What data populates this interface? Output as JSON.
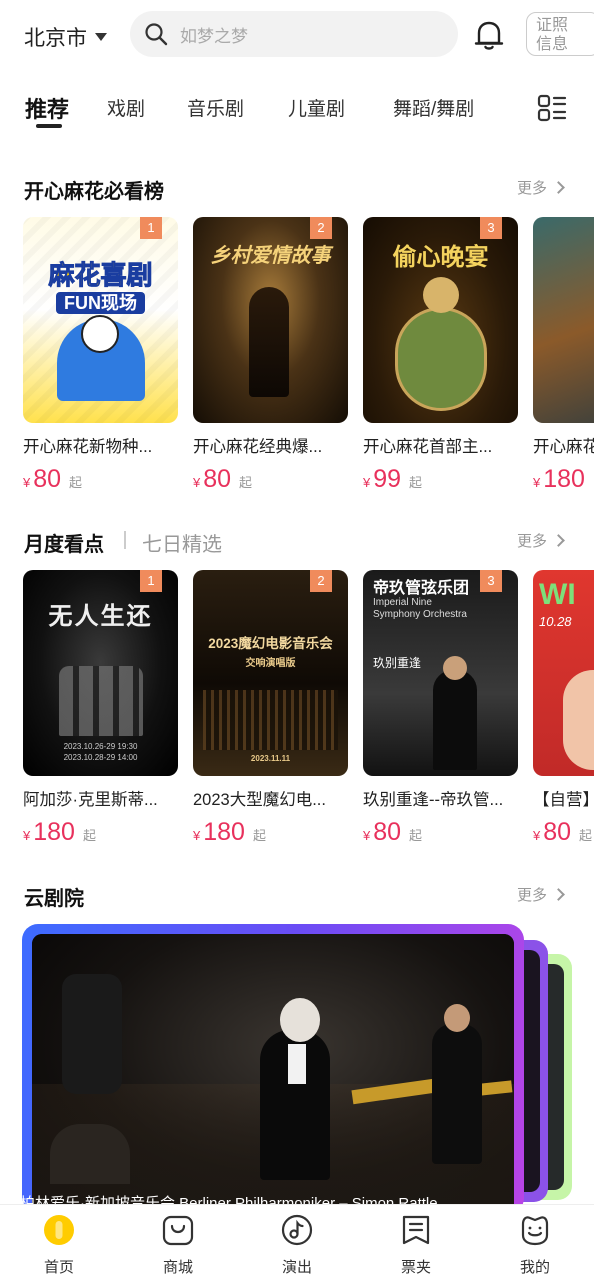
{
  "header": {
    "city": "北京市",
    "search_placeholder": "如梦之梦",
    "cert_label_line1": "证照",
    "cert_label_line2": "信息"
  },
  "tabs": [
    {
      "label": "推荐",
      "active": true
    },
    {
      "label": "戏剧",
      "active": false
    },
    {
      "label": "音乐剧",
      "active": false
    },
    {
      "label": "儿童剧",
      "active": false
    },
    {
      "label": "舞蹈/舞剧",
      "active": false
    }
  ],
  "sections": {
    "hot_list": {
      "title": "开心麻花必看榜",
      "more": "更多",
      "items": [
        {
          "rank": "1",
          "title": "开心麻花新物种...",
          "price": "80",
          "poster_text": [
            "麻花喜剧",
            "FUN现场"
          ]
        },
        {
          "rank": "2",
          "title": "开心麻花经典爆...",
          "price": "80",
          "poster_text": [
            "乡村爱情故事"
          ]
        },
        {
          "rank": "3",
          "title": "开心麻花首部主...",
          "price": "99",
          "poster_text": [
            "偷心晚宴"
          ]
        },
        {
          "rank": "",
          "title": "开心麻花",
          "price": "180",
          "poster_text": []
        }
      ]
    },
    "monthly": {
      "title": "月度看点",
      "subtitle": "七日精选",
      "more": "更多",
      "items": [
        {
          "rank": "1",
          "title": "阿加莎·克里斯蒂...",
          "price": "180",
          "poster_text": [
            "无人生还",
            "2023.10.26-29 19:30",
            "2023.10.28-29 14:00"
          ]
        },
        {
          "rank": "2",
          "title": "2023大型魔幻电...",
          "price": "180",
          "poster_text": [
            "2023魔幻电影音乐会",
            "交响演唱版",
            "2023.11.11"
          ]
        },
        {
          "rank": "3",
          "title": "玖别重逢--帝玖管...",
          "price": "80",
          "poster_text": [
            "帝玖管弦乐团",
            "Imperial Nine",
            "Symphony Orchestra",
            "玖别重逢"
          ]
        },
        {
          "rank": "",
          "title": "【自营】",
          "price": "80",
          "poster_text": [
            "10.28"
          ]
        }
      ]
    },
    "cloud": {
      "title": "云剧院",
      "more": "更多",
      "caption": "柏林爱乐·新加坡音乐会 Berliner Philharmoniker – Simon Rattle"
    }
  },
  "price_currency": "¥",
  "price_suffix": "起",
  "bottom_nav": [
    {
      "label": "首页",
      "icon": "home-icon",
      "active": true
    },
    {
      "label": "商城",
      "icon": "shop-bag-icon",
      "active": false
    },
    {
      "label": "演出",
      "icon": "music-note-icon",
      "active": false
    },
    {
      "label": "票夹",
      "icon": "ticket-folder-icon",
      "active": false
    },
    {
      "label": "我的",
      "icon": "profile-icon",
      "active": false
    }
  ],
  "colors": {
    "price": "#e8315c",
    "rank_badge": "#f08b5c",
    "active_nav": "#ffcc00"
  }
}
